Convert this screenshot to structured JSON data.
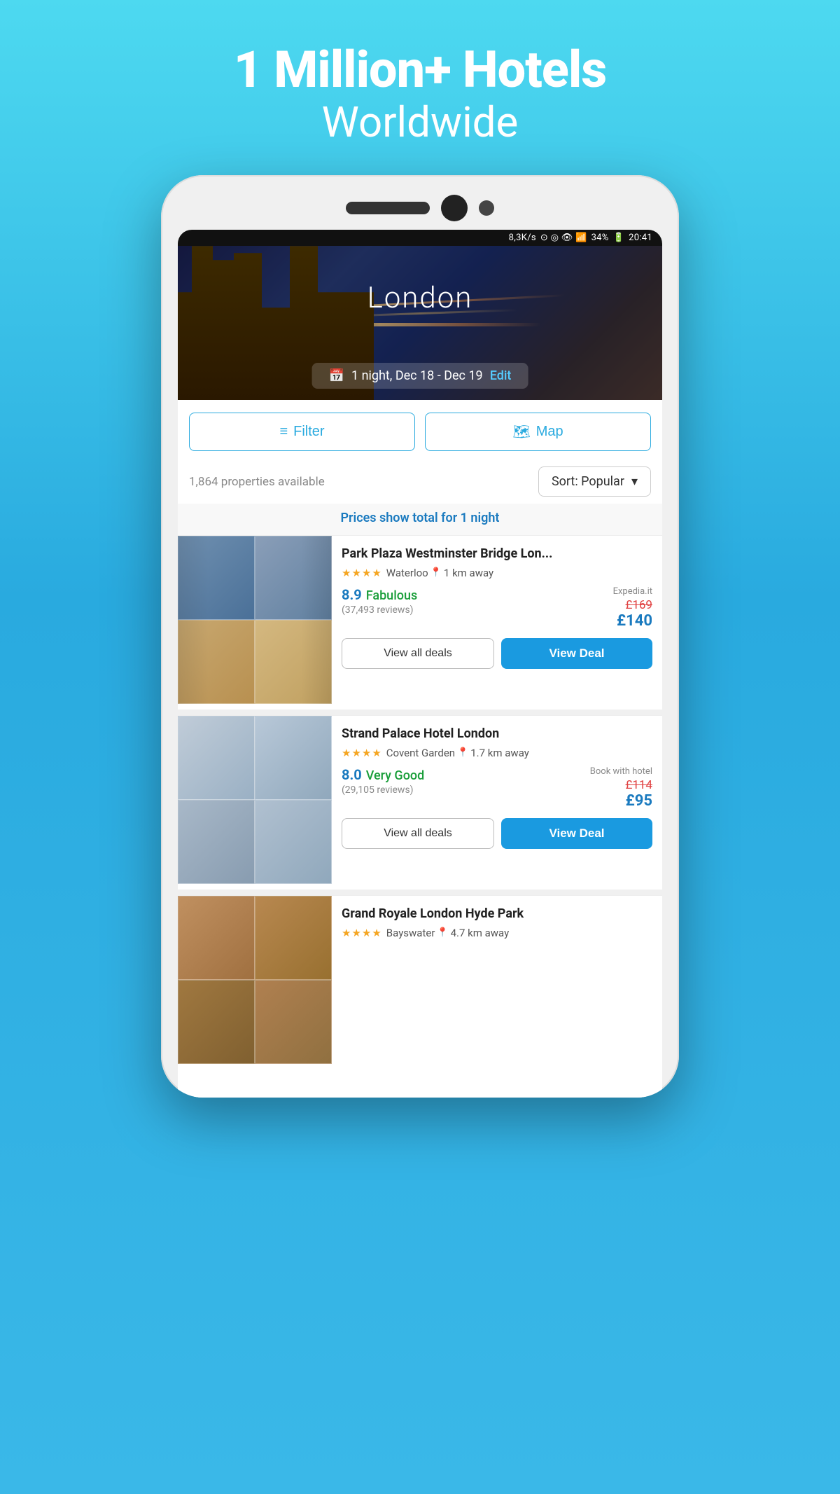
{
  "hero": {
    "title_line1": "1 Million+ Hotels",
    "title_line2": "Worldwide"
  },
  "status_bar": {
    "speed": "8,3K/s",
    "time": "20:41",
    "battery": "34%"
  },
  "search": {
    "city": "London",
    "nights": "1 night, Dec 18 - Dec 19",
    "edit_label": "Edit"
  },
  "filter_btn": "Filter",
  "map_btn": "Map",
  "properties_count": "1,864 properties available",
  "sort_label": "Sort: Popular",
  "prices_notice": "Prices show total for 1 night",
  "hotels": [
    {
      "name": "Park Plaza Westminster Bridge Lon...",
      "stars": "★★★★",
      "neighborhood": "Waterloo",
      "distance": "1 km away",
      "score": "8.9",
      "score_label": "Fabulous",
      "reviews": "(37,493 reviews)",
      "price_source": "Expedia.it",
      "price_original": "£169",
      "price_current": "£140",
      "view_all_deals": "View all deals",
      "view_deal": "View Deal",
      "img_type": "westminster"
    },
    {
      "name": "Strand Palace Hotel London",
      "stars": "★★★★",
      "neighborhood": "Covent Garden",
      "distance": "1.7 km away",
      "score": "8.0",
      "score_label": "Very Good",
      "reviews": "(29,105 reviews)",
      "price_source": "Book with hotel",
      "price_original": "£114",
      "price_current": "£95",
      "view_all_deals": "View all deals",
      "view_deal": "View Deal",
      "img_type": "strand"
    },
    {
      "name": "Grand Royale London Hyde Park",
      "stars": "★★★★",
      "neighborhood": "Bayswater",
      "distance": "4.7 km away",
      "score": "",
      "score_label": "",
      "reviews": "",
      "price_source": "",
      "price_original": "",
      "price_current": "",
      "view_all_deals": "",
      "view_deal": "",
      "img_type": "grand"
    }
  ]
}
